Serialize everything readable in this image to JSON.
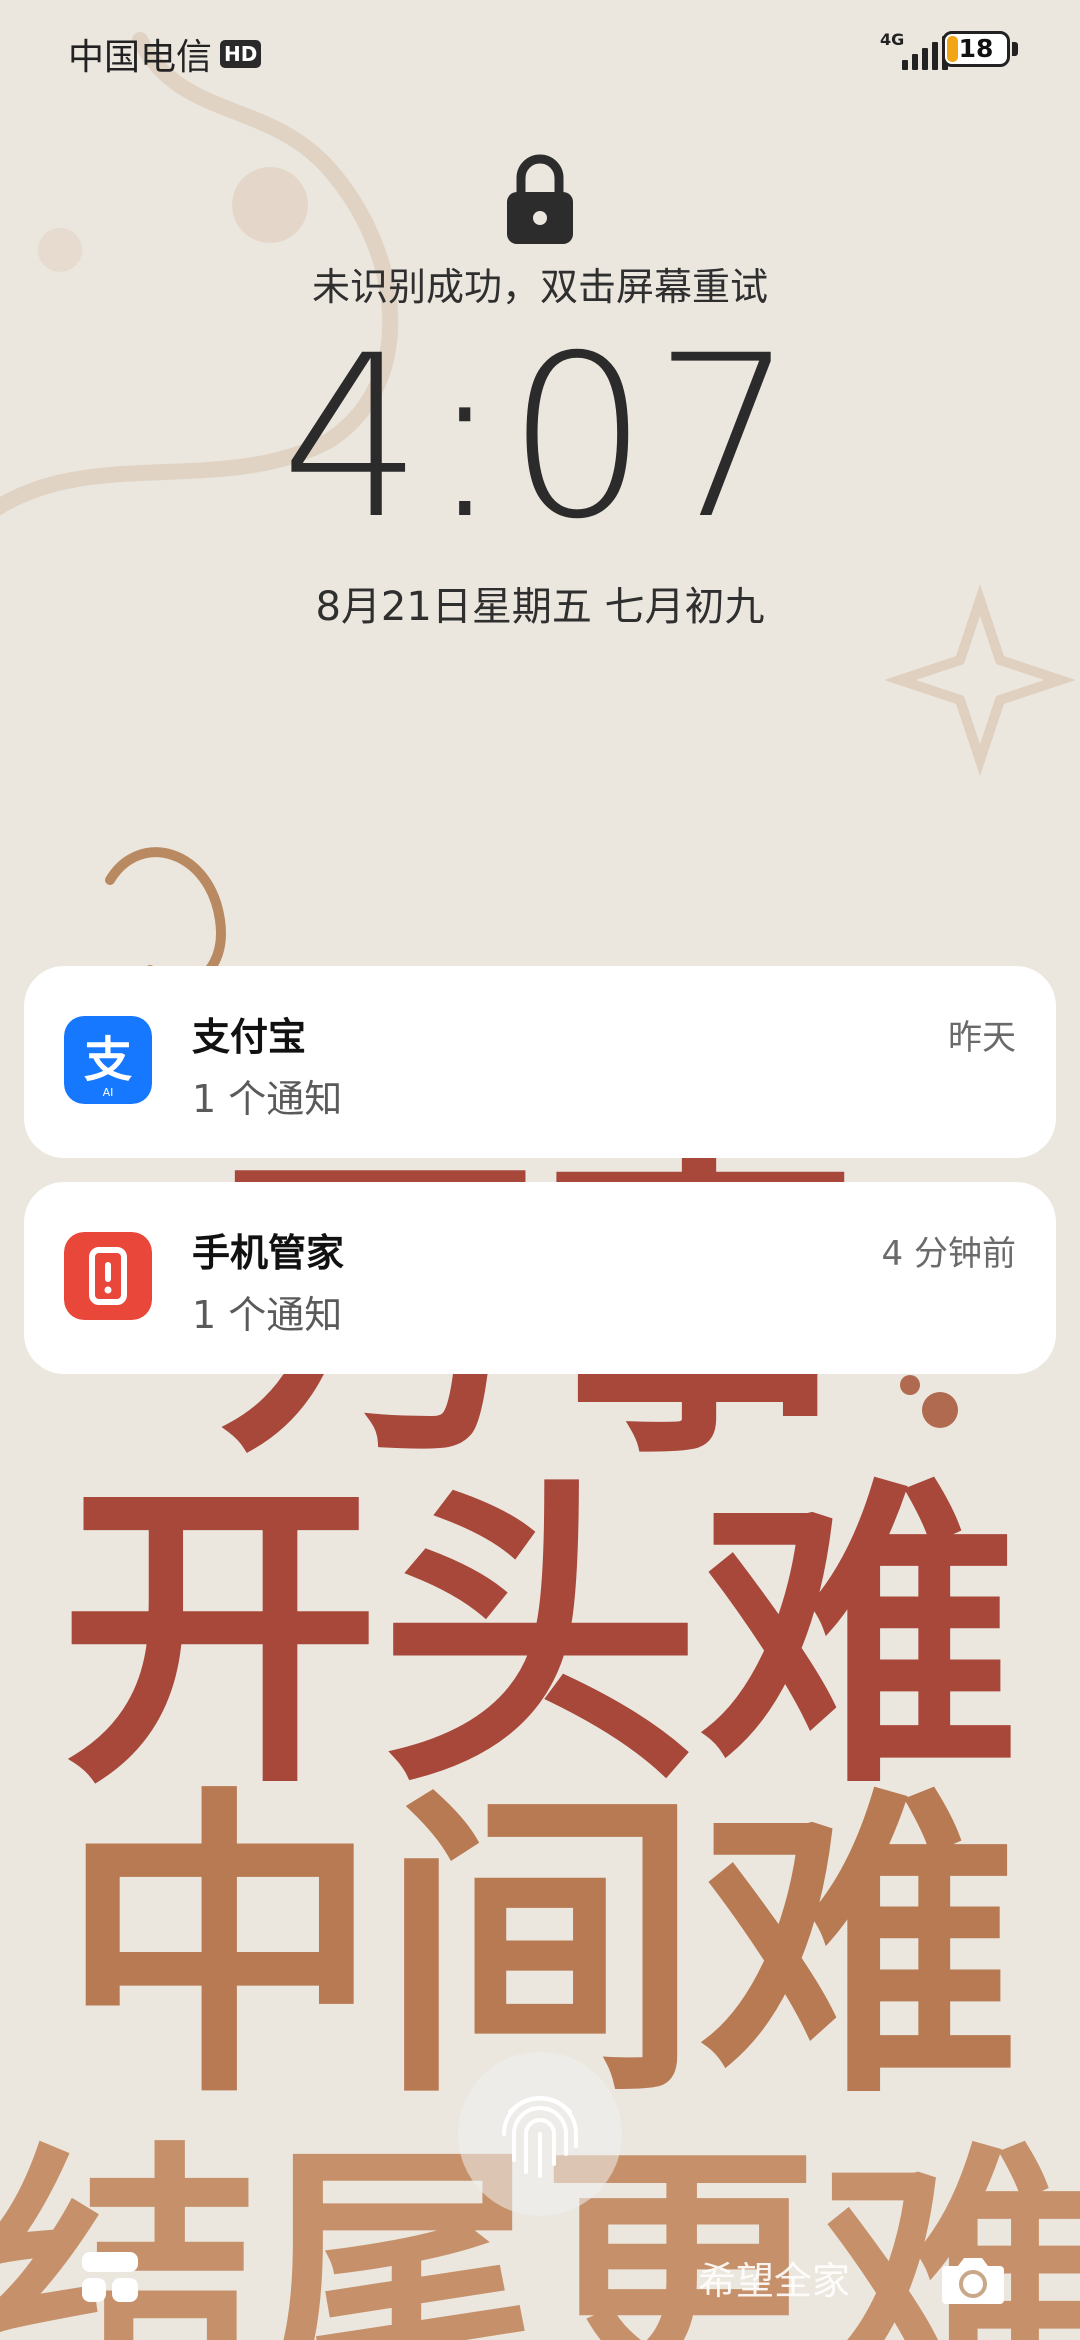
{
  "status_bar": {
    "carrier": "中国电信",
    "hd_badge": "HD",
    "network": "4G",
    "battery_level": "18",
    "battery_fraction": 0.18
  },
  "lock_screen": {
    "lock_icon": "lock-icon",
    "unlock_hint": "未识别成功，双击屏幕重试",
    "time": "4:07",
    "date": "8月21日星期五  七月初九"
  },
  "notifications": [
    {
      "app": "支付宝",
      "message": "1 个通知",
      "time": "昨天",
      "icon": "alipay-icon",
      "color": "#1677ff"
    },
    {
      "app": "手机管家",
      "message": "1 个通知",
      "time": "4 分钟前",
      "icon": "phone-manager-icon",
      "color": "#e8473a"
    }
  ],
  "wallpaper": {
    "lines": [
      "开头难",
      "中间难",
      "结尾更难"
    ],
    "partial_top": "万事",
    "colors": {
      "line1": "#a8483b",
      "line2": "#b87a52",
      "line3": "#c6916a"
    }
  },
  "bottom_bar": {
    "left_icon": "widgets-icon",
    "fingerprint_icon": "fingerprint-icon",
    "text": "希望全家",
    "right_icon": "camera-icon"
  }
}
